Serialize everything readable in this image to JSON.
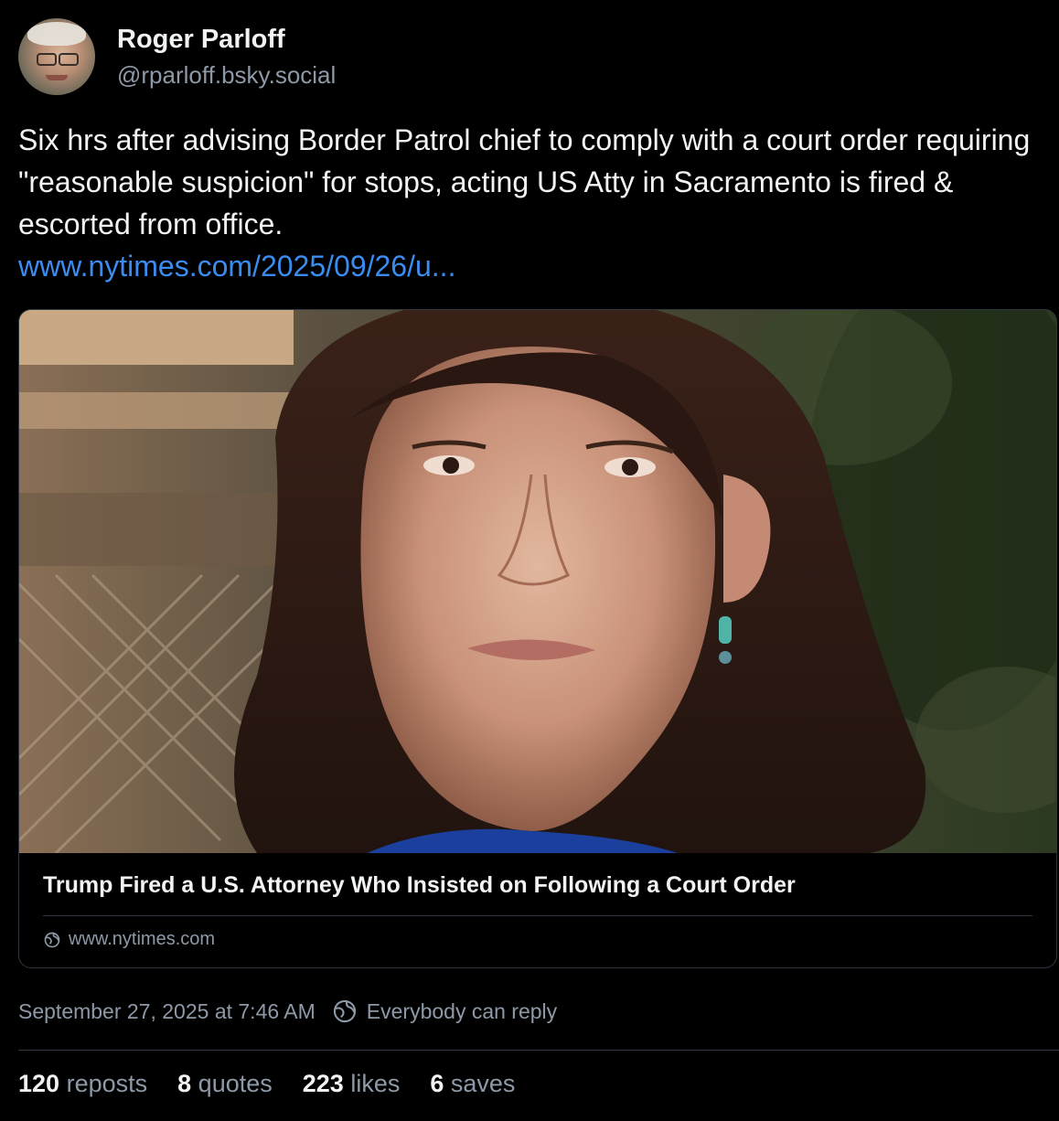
{
  "author": {
    "display_name": "Roger Parloff",
    "handle": "@rparloff.bsky.social"
  },
  "post": {
    "text": "Six hrs after advising Border Patrol chief to comply with a court order requiring \"reasonable suspicion\" for stops, acting US Atty in Sacramento is fired & escorted from office.",
    "link_text": "www.nytimes.com/2025/09/26/u..."
  },
  "card": {
    "title": "Trump Fired a U.S. Attorney Who Insisted on Following a Court Order",
    "domain": "www.nytimes.com",
    "domain_icon": "globe-icon"
  },
  "meta": {
    "timestamp": "September 27, 2025 at 7:46 AM",
    "reply_setting": "Everybody can reply",
    "reply_icon": "globe-icon"
  },
  "stats": [
    {
      "count": "120",
      "label": "reposts"
    },
    {
      "count": "8",
      "label": "quotes"
    },
    {
      "count": "223",
      "label": "likes"
    },
    {
      "count": "6",
      "label": "saves"
    }
  ],
  "colors": {
    "background": "#000000",
    "text": "#f1f3f5",
    "secondary": "#8e99a8",
    "link": "#3b8cf0",
    "border": "#2e3641"
  }
}
